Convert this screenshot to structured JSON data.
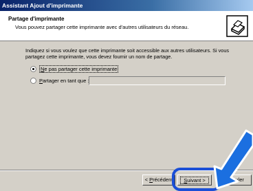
{
  "window": {
    "title": "Assistant Ajout d'imprimante"
  },
  "header": {
    "title": "Partage d'imprimante",
    "subtitle": "Vous pouvez partager cette imprimante avec d'autres utilisateurs du réseau.",
    "icon": "printer-wizard-icon"
  },
  "body": {
    "description_line1": "Indiquez si vous voulez que cette imprimante soit accessible aux autres utilisateurs. Si vous",
    "description_line2": "partagez cette imprimante, vous devez fournir un nom de partage.",
    "option_no_share": {
      "prefix": "N",
      "rest": "e pas partager cette imprimante",
      "selected": true
    },
    "option_share": {
      "prefix": "P",
      "rest": "artager en tant que :",
      "selected": false
    },
    "share_name_value": ""
  },
  "buttons": {
    "back_prefix": "< ",
    "back_underline": "P",
    "back_rest": "récédent",
    "next_underline": "S",
    "next_rest": "uivant >",
    "cancel": "Annuler"
  },
  "colors": {
    "highlight": "#1b4fd6",
    "titlebar": "#0a246a"
  }
}
